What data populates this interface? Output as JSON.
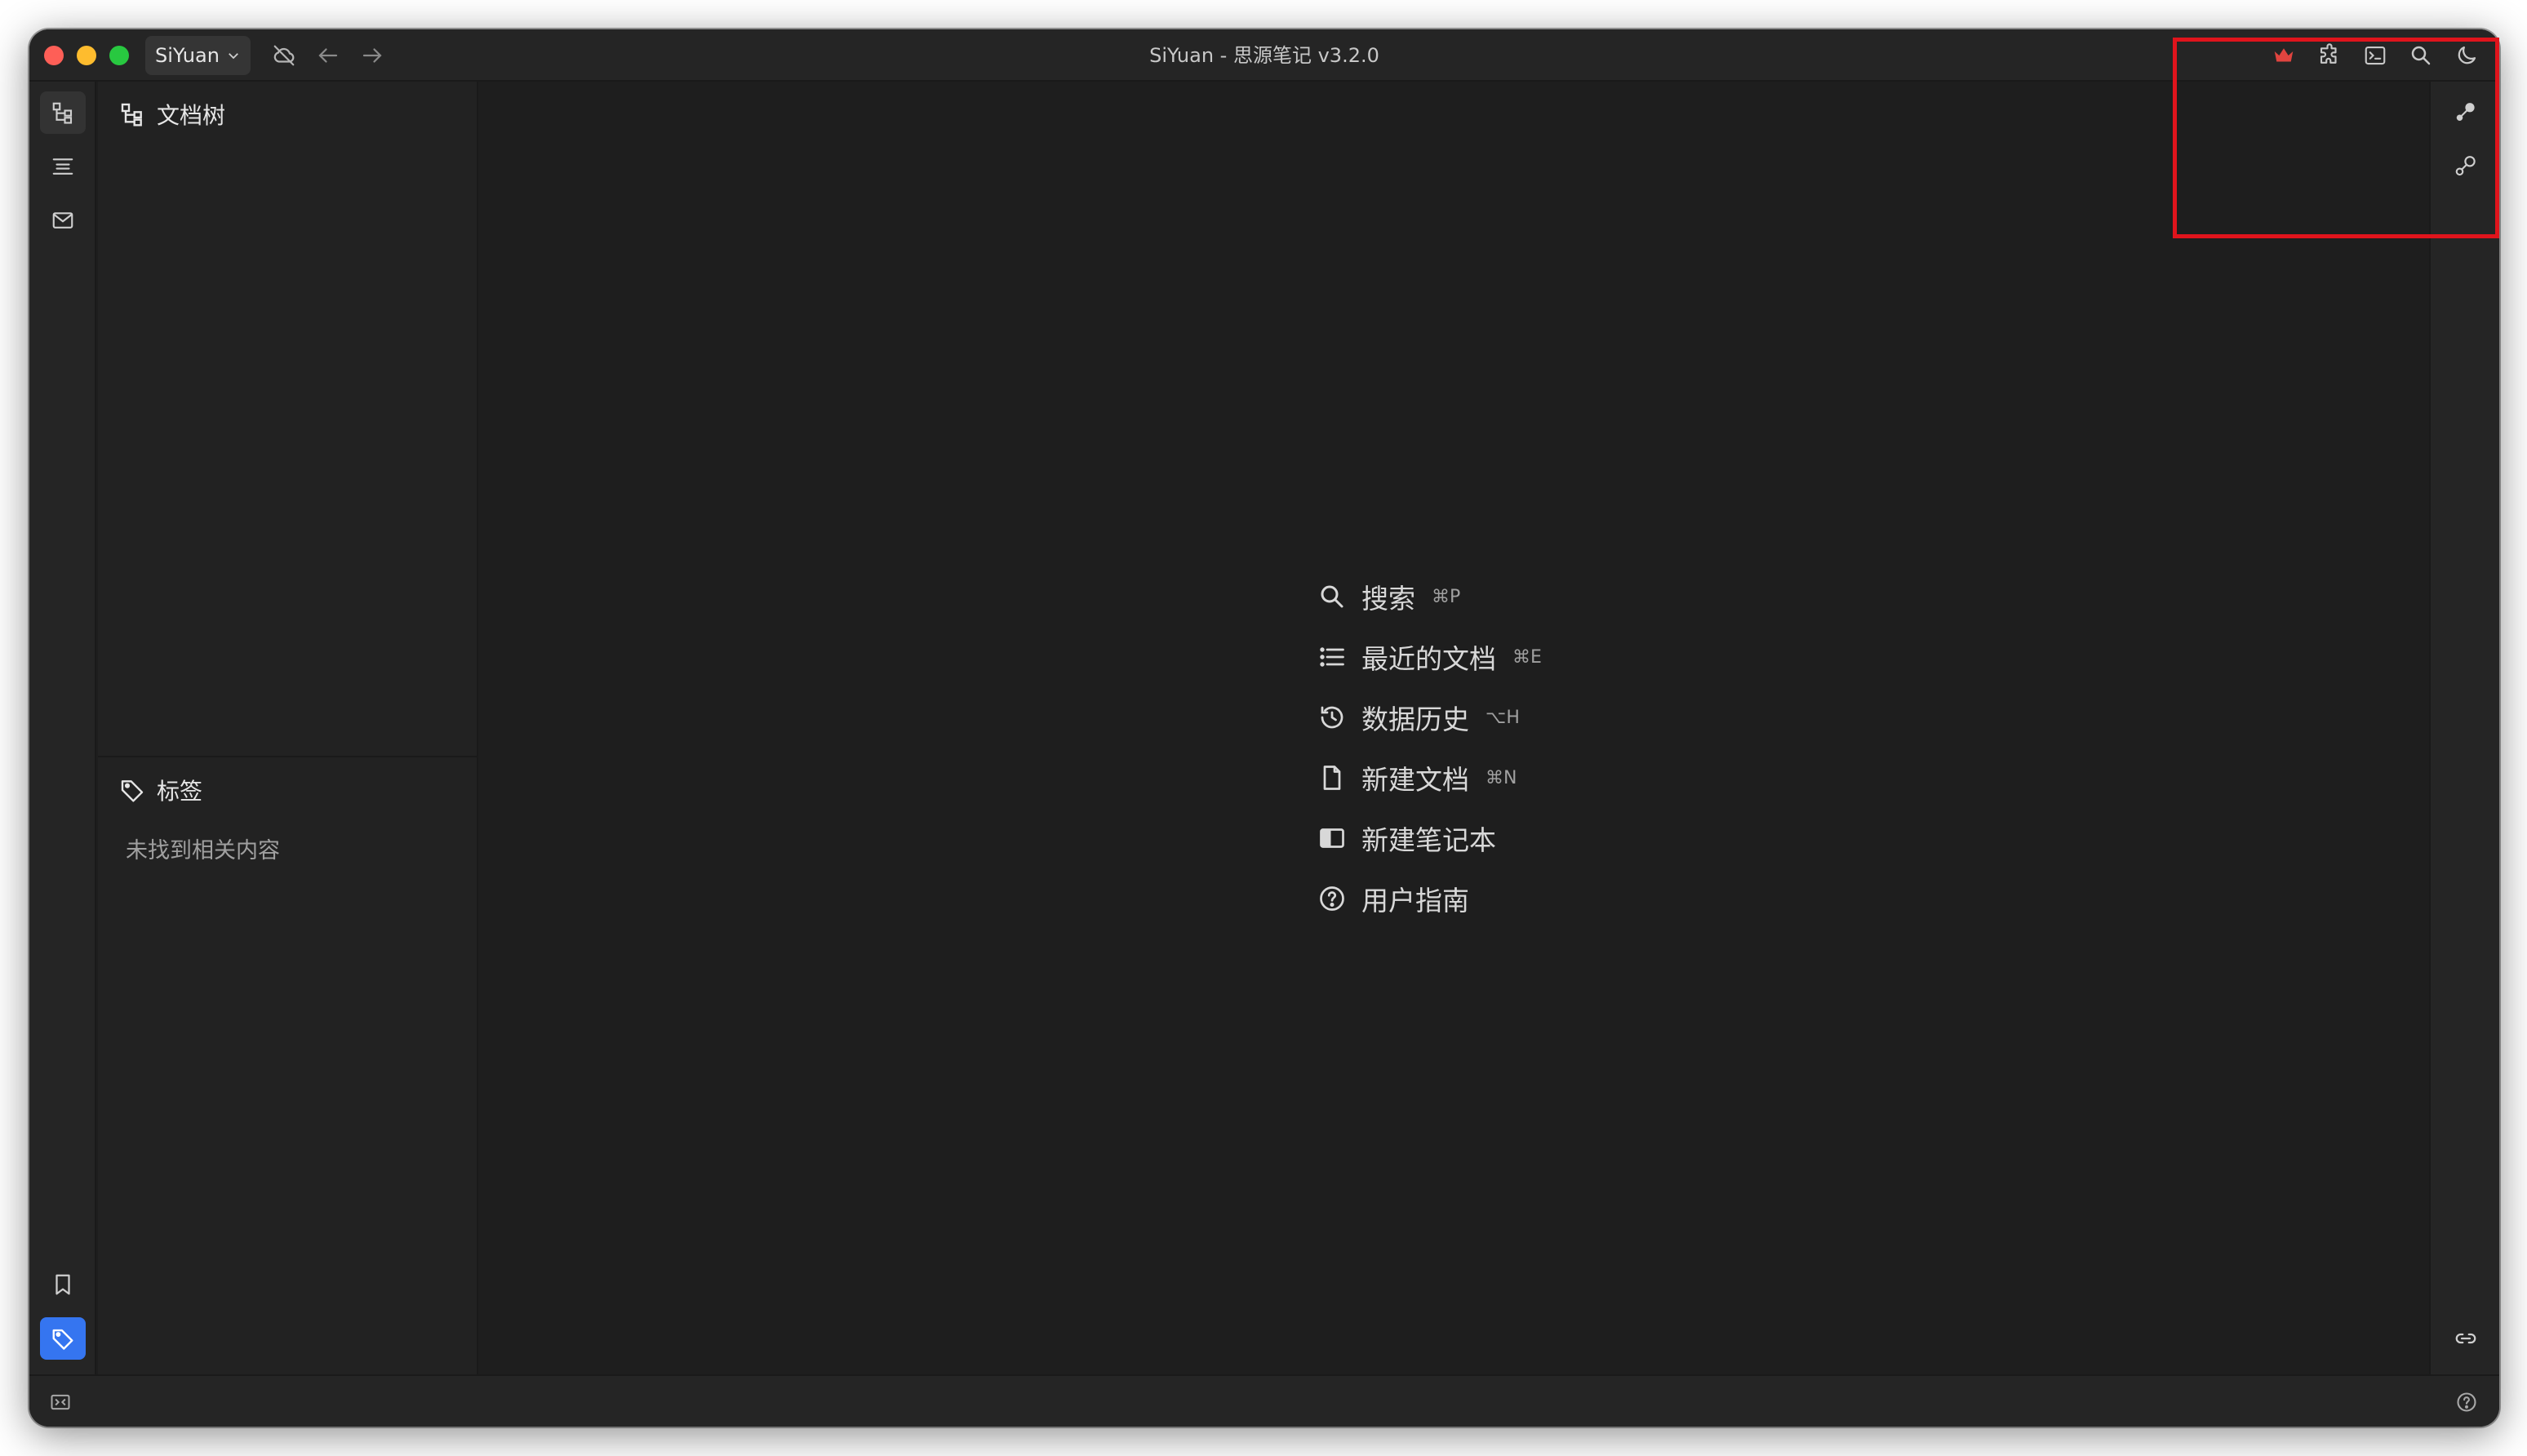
{
  "window": {
    "title": "SiYuan - 思源笔记 v3.2.0",
    "workspace_label": "SiYuan"
  },
  "toolbar": {
    "left_icons": [
      "cloud-off-icon",
      "back-arrow-icon",
      "forward-arrow-icon"
    ],
    "right_icons": [
      "crown-icon",
      "plugin-icon",
      "terminal-icon",
      "search-icon",
      "moon-icon"
    ]
  },
  "left_dock": {
    "top_icons": [
      "file-tree-icon",
      "outline-icon",
      "inbox-icon"
    ],
    "bottom_icons": [
      "bookmark-icon",
      "tag-icon"
    ]
  },
  "file_tree": {
    "title": "文档树"
  },
  "tags_panel": {
    "title": "标签",
    "empty_text": "未找到相关内容"
  },
  "empty_menu": {
    "items": [
      {
        "label": "搜索",
        "shortcut": "⌘P",
        "icon": "search-icon"
      },
      {
        "label": "最近的文档",
        "shortcut": "⌘E",
        "icon": "list-icon"
      },
      {
        "label": "数据历史",
        "shortcut": "⌥H",
        "icon": "history-icon"
      },
      {
        "label": "新建文档",
        "shortcut": "⌘N",
        "icon": "file-icon"
      },
      {
        "label": "新建笔记本",
        "shortcut": "",
        "icon": "notebook-icon"
      },
      {
        "label": "用户指南",
        "shortcut": "",
        "icon": "help-icon"
      }
    ]
  },
  "right_dock": {
    "icons": [
      "graph-icon",
      "global-graph-icon",
      "backlink-icon"
    ]
  },
  "statusbar": {
    "icons": [
      "dock-toggle-icon",
      "help-icon"
    ]
  },
  "colors": {
    "accent": "#3575f0",
    "crown": "#e0443f",
    "highlight": "#e0141c",
    "background": "#1e1e1e"
  }
}
